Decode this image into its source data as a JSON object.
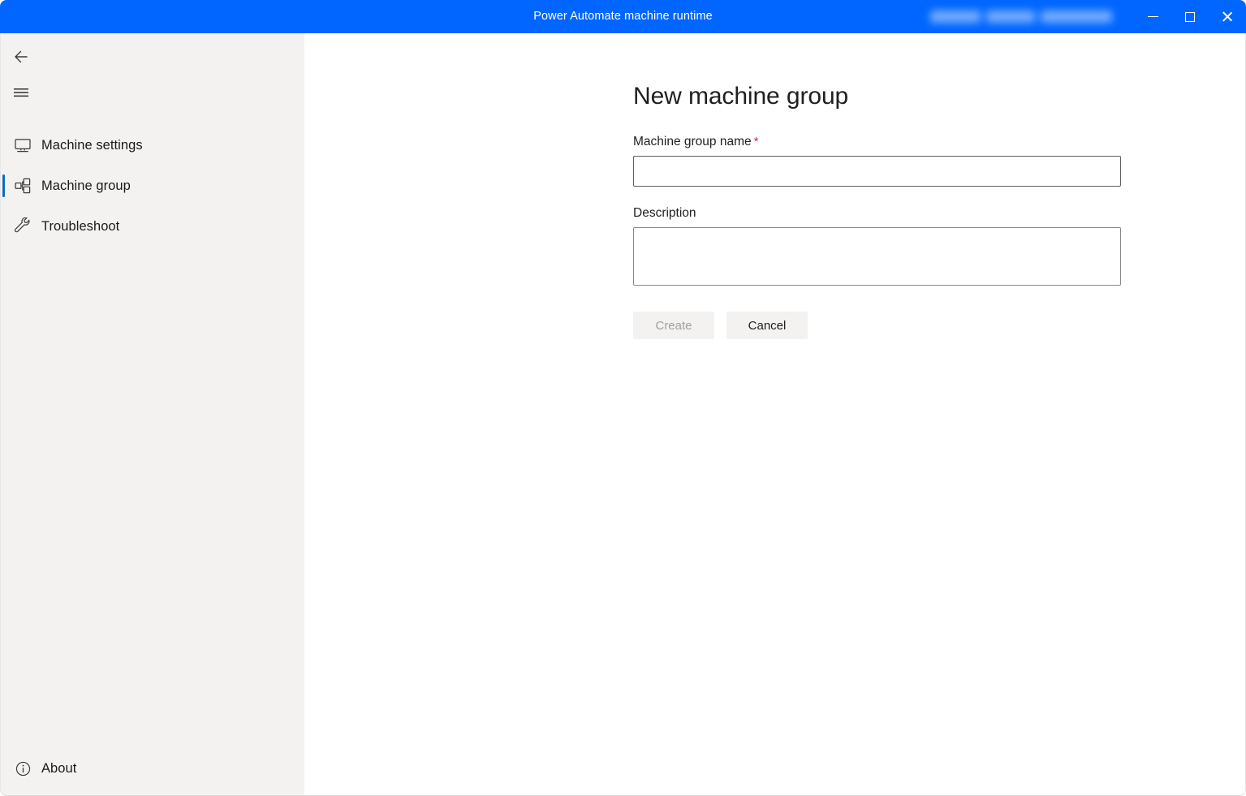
{
  "window": {
    "title": "Power Automate machine runtime",
    "account_redacted": [
      "",
      "",
      ""
    ],
    "controls": {
      "minimize": "Minimize",
      "maximize": "Maximize",
      "close": "Close"
    },
    "accent_color": "#0066ff"
  },
  "sidebar": {
    "back_label": "Back",
    "menu_label": "Navigation menu",
    "selected_index": 1,
    "accent_color": "#0f6cbd",
    "background_color": "#f3f2f1",
    "items": [
      {
        "label": "Machine settings",
        "icon": "monitor-icon"
      },
      {
        "label": "Machine group",
        "icon": "machine-group-icon"
      },
      {
        "label": "Troubleshoot",
        "icon": "wrench-icon"
      }
    ],
    "bottom": {
      "label": "About",
      "icon": "info-circle-icon"
    }
  },
  "main": {
    "title": "New machine group",
    "fields": [
      {
        "label": "Machine group name",
        "required": true,
        "required_marker": "*",
        "required_color": "#c4314b",
        "value": "",
        "placeholder": ""
      },
      {
        "label": "Description",
        "required": false,
        "required_marker": "",
        "value": "",
        "placeholder": ""
      }
    ],
    "buttons": {
      "create": {
        "label": "Create",
        "enabled": false
      },
      "cancel": {
        "label": "Cancel",
        "enabled": true
      }
    }
  }
}
